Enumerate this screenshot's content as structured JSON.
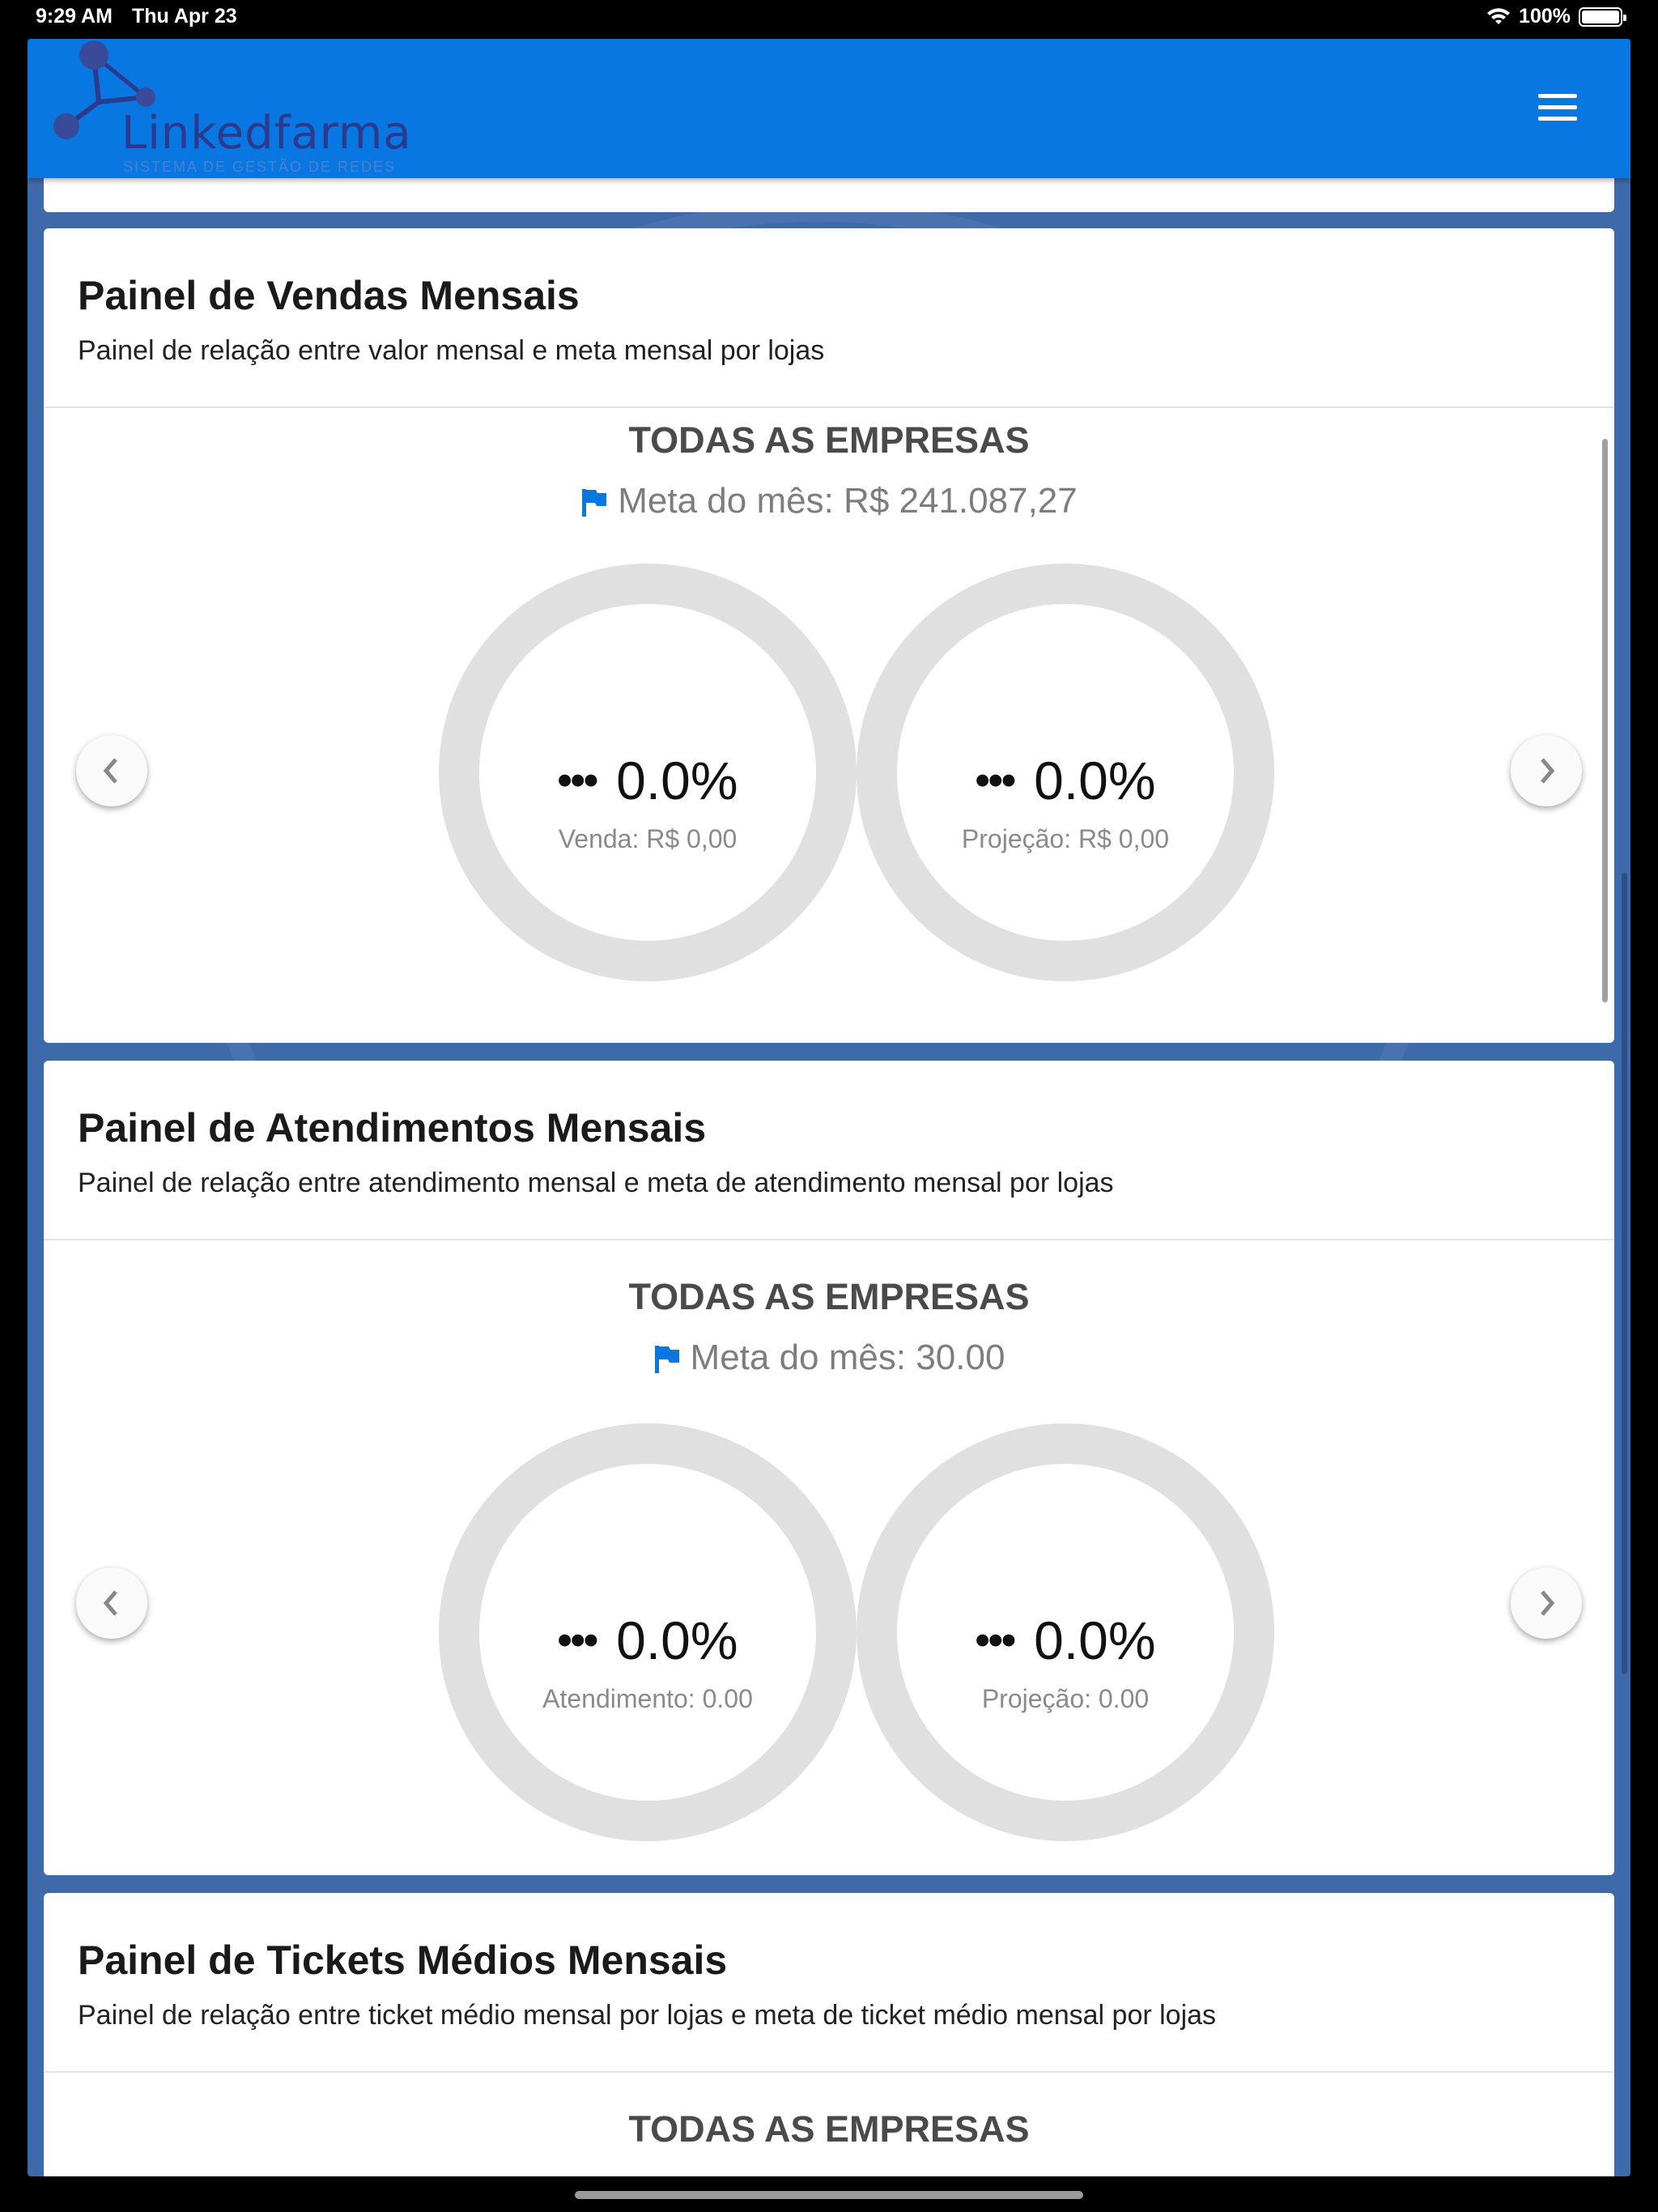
{
  "status_bar": {
    "time": "9:29 AM",
    "date": "Thu Apr 23",
    "battery": "100%"
  },
  "header": {
    "logo_text": "Linkedfarma",
    "logo_subtitle": "SISTEMA DE GESTÃO DE REDES",
    "menu_icon": "hamburger-menu-icon",
    "bg_color": "#0877e1"
  },
  "panels": [
    {
      "title": "Painel de Vendas Mensais",
      "description": "Painel de relação entre valor mensal e meta mensal por lojas",
      "company": "TODAS AS EMPRESAS",
      "goal": "Meta do mês: R$ 241.087,27",
      "ring1": {
        "value": "0.0%",
        "label": "Venda: R$ 0,00"
      },
      "ring2": {
        "value": "0.0%",
        "label": "Projeção: R$ 0,00"
      }
    },
    {
      "title": "Painel de Atendimentos Mensais",
      "description": "Painel de relação entre atendimento mensal e meta de atendimento mensal por lojas",
      "company": "TODAS AS EMPRESAS",
      "goal": "Meta do mês: 30.00",
      "ring1": {
        "value": "0.0%",
        "label": "Atendimento: 0.00"
      },
      "ring2": {
        "value": "0.0%",
        "label": "Projeção: 0.00"
      }
    },
    {
      "title": "Painel de Tickets Médios Mensais",
      "description": "Painel de relação entre ticket médio mensal por lojas e meta de ticket médio mensal por lojas",
      "company": "TODAS AS EMPRESAS"
    }
  ],
  "colors": {
    "accent": "#0877e1",
    "ring_track": "#e0e0e0",
    "background": "#3f6aa9"
  }
}
